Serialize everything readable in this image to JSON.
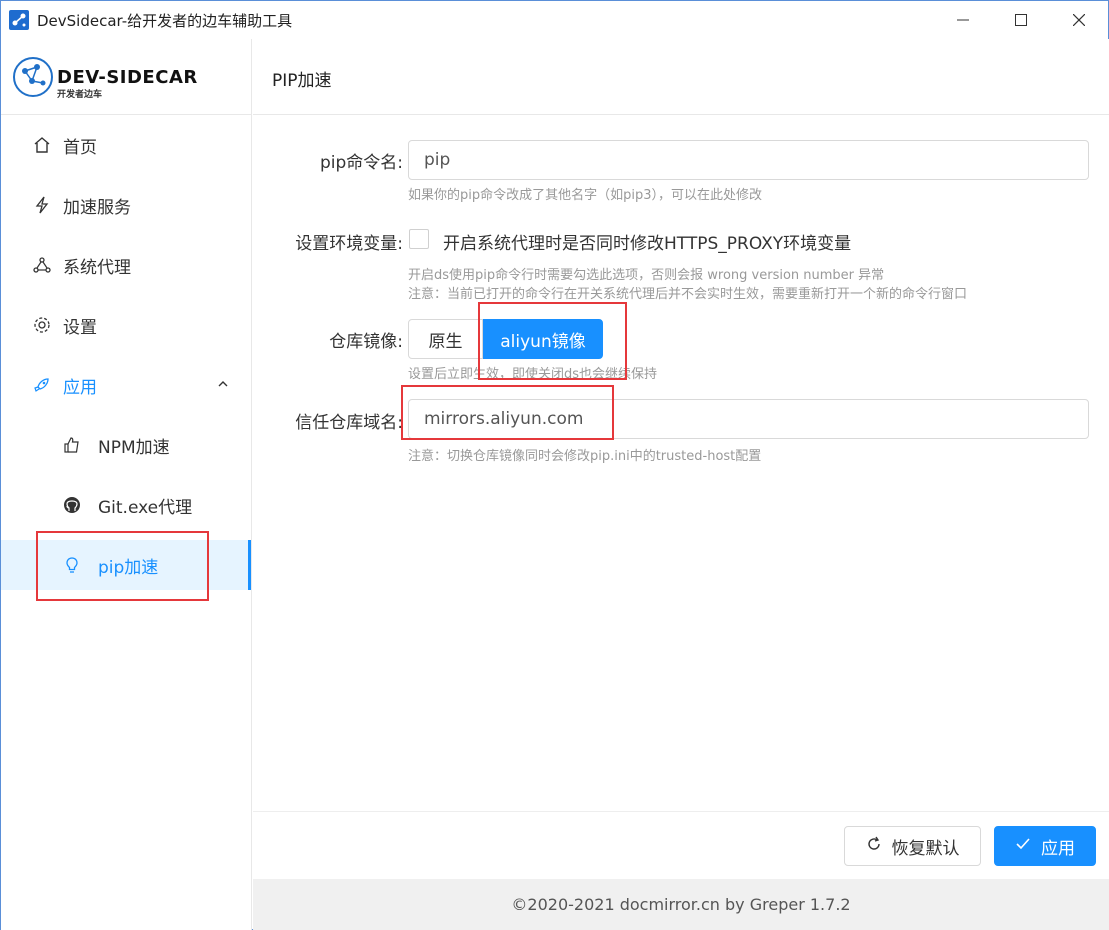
{
  "window": {
    "title": "DevSidecar-给开发者的边车辅助工具",
    "minimize_icon": "minimize-icon",
    "maximize_icon": "maximize-icon",
    "close_icon": "close-icon"
  },
  "logo": {
    "title": "DEV-SIDECAR",
    "subtitle": "开发者边车"
  },
  "sidebar": {
    "items": [
      {
        "label": "首页",
        "icon": "home-icon"
      },
      {
        "label": "加速服务",
        "icon": "lightning-icon"
      },
      {
        "label": "系统代理",
        "icon": "network-icon"
      },
      {
        "label": "设置",
        "icon": "gear-icon"
      },
      {
        "label": "应用",
        "icon": "rocket-icon"
      },
      {
        "label": "NPM加速",
        "icon": "thumbs-up-icon"
      },
      {
        "label": "Git.exe代理",
        "icon": "github-icon"
      },
      {
        "label": "pip加速",
        "icon": "bulb-icon"
      }
    ],
    "active_index": 7
  },
  "page": {
    "title": "PIP加速",
    "pip_name": {
      "label": "pip命令名:",
      "value": "pip",
      "help": "如果你的pip命令改成了其他名字（如pip3），可以在此处修改"
    },
    "env": {
      "label": "设置环境变量:",
      "checkbox_label": "开启系统代理时是否同时修改HTTPS_PROXY环境变量",
      "checked": false,
      "help1": "开启ds使用pip命令行时需要勾选此选项，否则会报 wrong version number 异常",
      "help2": "注意：当前已打开的命令行在开关系统代理后并不会实时生效，需要重新打开一个新的命令行窗口"
    },
    "mirror": {
      "label": "仓库镜像:",
      "options": [
        "原生",
        "aliyun镜像"
      ],
      "selected": "aliyun镜像",
      "help": "设置后立即生效，即使关闭ds也会继续保持"
    },
    "trusted_host": {
      "label": "信任仓库域名:",
      "value": "mirrors.aliyun.com",
      "help": "注意：切换仓库镜像同时会修改pip.ini中的trusted-host配置"
    }
  },
  "actions": {
    "reset_label": "恢复默认",
    "apply_label": "应用"
  },
  "footer": {
    "copyright": "©2020-2021 docmirror.cn by Greper 1.7.2"
  },
  "colors": {
    "primary": "#1890ff",
    "highlight_box": "#e5383b",
    "active_bg": "#e6f4ff"
  }
}
